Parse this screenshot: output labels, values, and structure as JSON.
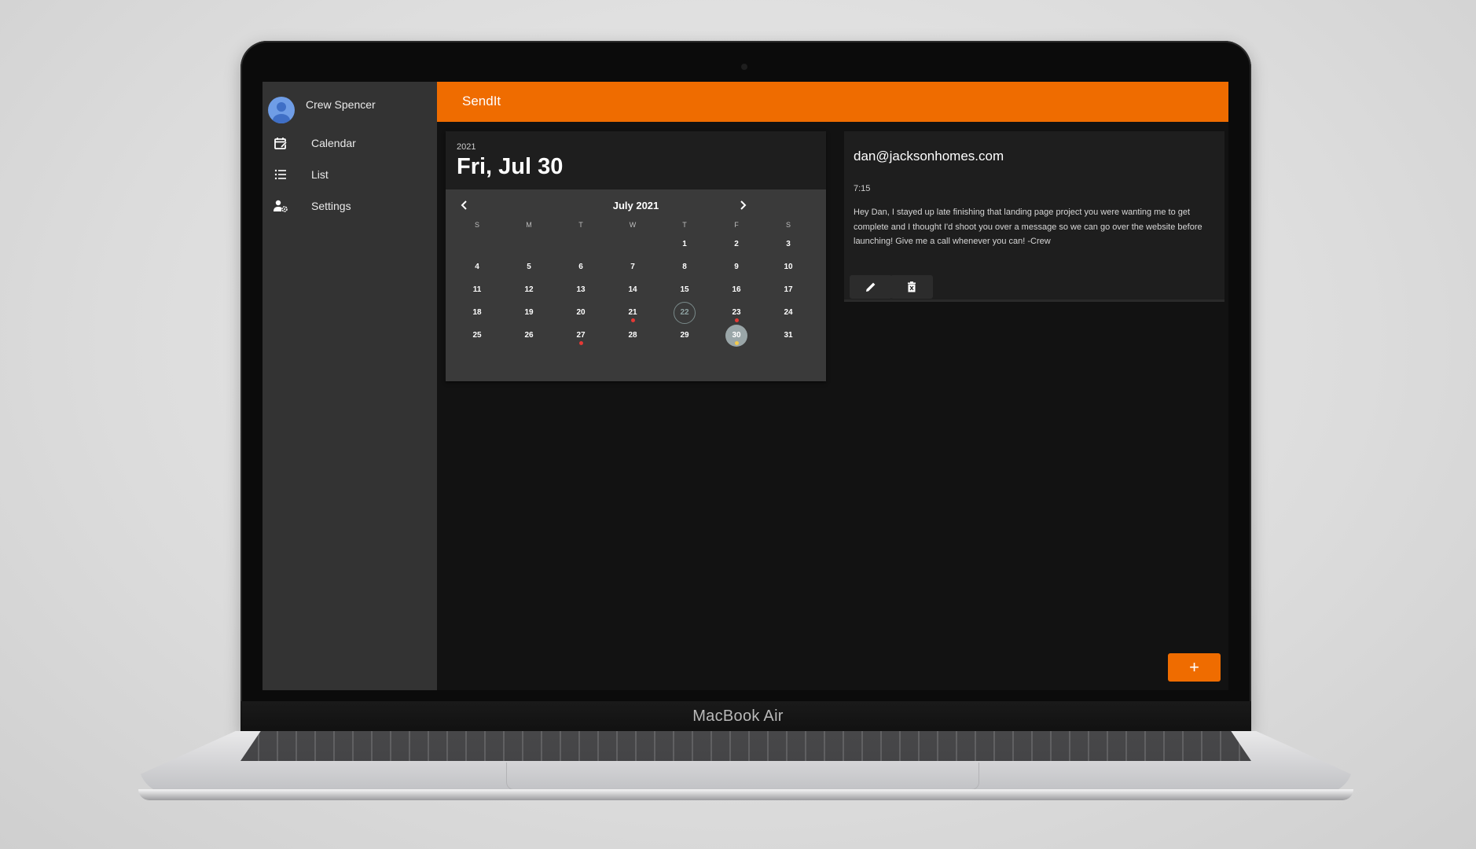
{
  "device": {
    "brand_label": "MacBook Air"
  },
  "sidebar": {
    "user_name": "Crew Spencer",
    "items": [
      {
        "label": "Calendar",
        "icon": "calendar-edit-icon"
      },
      {
        "label": "List",
        "icon": "list-icon"
      },
      {
        "label": "Settings",
        "icon": "user-settings-icon"
      }
    ]
  },
  "header": {
    "title": "SendIt",
    "accent_color": "#ef6c00"
  },
  "calendar": {
    "year": "2021",
    "selected_date": "Fri, Jul 30",
    "month_label": "July 2021",
    "prev_icon": "chevron-left-icon",
    "next_icon": "chevron-right-icon",
    "weekdays": [
      "S",
      "M",
      "T",
      "W",
      "T",
      "F",
      "S"
    ],
    "weeks": [
      [
        "",
        "",
        "",
        "",
        "1",
        "2",
        "3"
      ],
      [
        "4",
        "5",
        "6",
        "7",
        "8",
        "9",
        "10"
      ],
      [
        "11",
        "12",
        "13",
        "14",
        "15",
        "16",
        "17"
      ],
      [
        "18",
        "19",
        "20",
        "21",
        "22",
        "23",
        "24"
      ],
      [
        "25",
        "26",
        "27",
        "28",
        "29",
        "30",
        "31"
      ]
    ],
    "today": "22",
    "selected": "30",
    "event_days_red": [
      "21",
      "23",
      "27"
    ],
    "event_days_yellow": [
      "30"
    ]
  },
  "message": {
    "email": "dan@jacksonhomes.com",
    "time": "7:15",
    "body": "Hey Dan, I stayed up late finishing that landing page project you were wanting me to get complete and I thought I'd shoot you over a message so we can go over the website before launching! Give me a call whenever you can! -Crew",
    "edit_icon": "pencil-icon",
    "delete_icon": "delete-icon"
  },
  "fab": {
    "label": "+"
  }
}
